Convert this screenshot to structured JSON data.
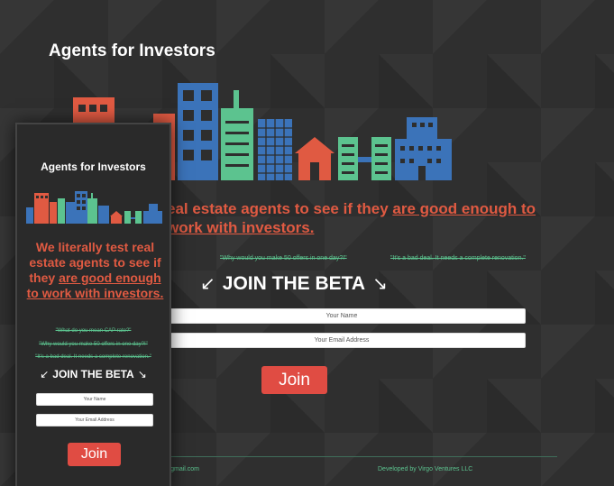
{
  "desktop": {
    "title": "Agents for Investors",
    "headline_lead": "eal estate agents to see if they ",
    "headline_link": "are good enough to work with investors.",
    "quotes": [
      "\"Why would you make 50 offers in one day?!\"",
      "\"It's a bad deal. It needs a complete renovation.\""
    ],
    "join_beta": "JOIN THE BETA",
    "name_placeholder": "Your Name",
    "email_placeholder": "Your Email Address",
    "join_button": "Join",
    "footer_left": "@gmail.com",
    "footer_right": "Developed by Virgo Ventures LLC"
  },
  "mobile": {
    "title": "Agents for Investors",
    "headline_lead": "We literally test real estate agents to see if they ",
    "headline_link": "are good enough to work with investors.",
    "quotes": [
      "\"What do you mean CAP rate?\"",
      "\"Why would you make 50 offers in one day?!\"",
      "\"It's a bad deal. It needs a complete renovation.\""
    ],
    "join_beta": "JOIN THE BETA",
    "name_placeholder": "Your Name",
    "email_placeholder": "Your Email Address",
    "join_button": "Join"
  },
  "colors": {
    "accent_red": "#e05a42",
    "accent_green": "#5cc38f",
    "building_blue": "#3b73b9",
    "background": "#2e2e2e"
  },
  "icons": {
    "curved_arrow_left": "curved-arrow-left-icon",
    "curved_arrow_right": "curved-arrow-right-icon"
  }
}
